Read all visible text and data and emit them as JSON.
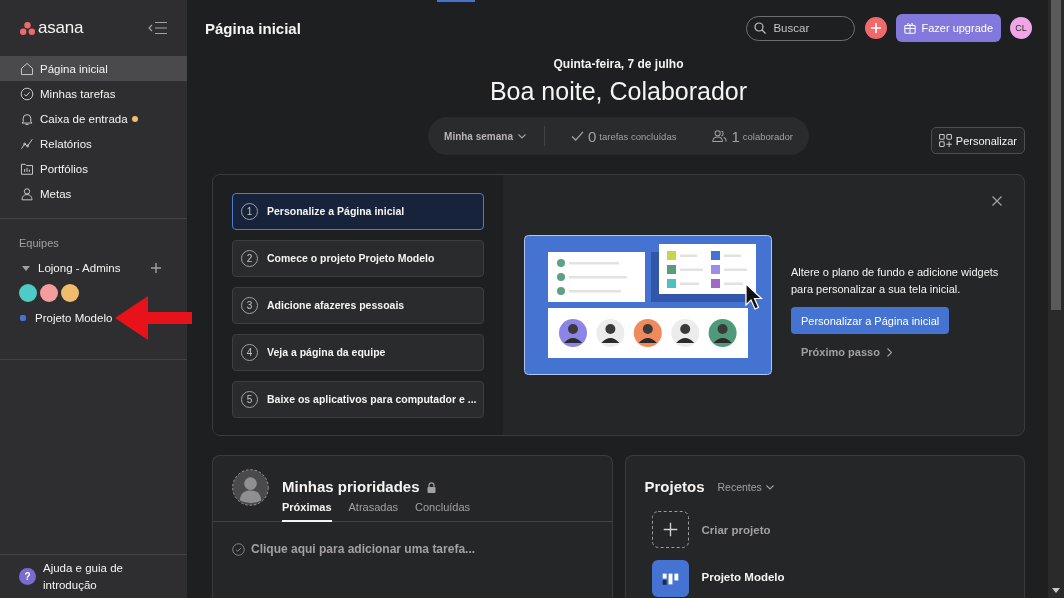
{
  "sidebar": {
    "logo": "asana",
    "nav": [
      {
        "label": "Página inicial",
        "selected": true,
        "unread": false
      },
      {
        "label": "Minhas tarefas",
        "selected": false,
        "unread": false
      },
      {
        "label": "Caixa de entrada",
        "selected": false,
        "unread": true
      },
      {
        "label": "Relatórios",
        "selected": false,
        "unread": false
      },
      {
        "label": "Portfólios",
        "selected": false,
        "unread": false
      },
      {
        "label": "Metas",
        "selected": false,
        "unread": false
      }
    ],
    "teams_heading": "Equipes",
    "team": {
      "name": "Lojong - Admins",
      "expanded": true,
      "members": [
        {
          "color": "#4ecbc4"
        },
        {
          "color": "#f59c9c"
        },
        {
          "color": "#f1bd6c"
        }
      ]
    },
    "projects": [
      {
        "name": "Projeto Modelo",
        "color": "#4573d2"
      }
    ],
    "help": {
      "icon": "?",
      "label": "Ajuda e guia de introdução"
    }
  },
  "header": {
    "title": "Página inicial",
    "search": {
      "placeholder": "Buscar"
    },
    "upgrade_button": "Fazer upgrade",
    "avatar": "CL"
  },
  "greeting": {
    "date": "Quinta-feira, 7 de julho",
    "title": "Boa noite, Colaborador"
  },
  "stats": {
    "period": "Minha semana",
    "tasks_count": "0",
    "tasks_label": "tarefas concluídas",
    "collaborators_count": "1",
    "collaborators_label": "colaborador"
  },
  "customize_button": "Personalizar",
  "onboarding": {
    "steps": [
      {
        "number": "1",
        "label": "Personalize a Página inicial",
        "selected": true
      },
      {
        "number": "2",
        "label": "Comece o projeto Projeto Modelo",
        "selected": false
      },
      {
        "number": "3",
        "label": "Adicione afazeres pessoais",
        "selected": false
      },
      {
        "number": "4",
        "label": "Veja a página da equipe",
        "selected": false
      },
      {
        "number": "5",
        "label": "Baixe os aplicativos para computador e ...",
        "selected": false
      }
    ],
    "description": "Altere o plano de fundo e adicione widgets para personalizar a sua tela inicial.",
    "primary_button": "Personalizar a Página inicial",
    "next_link": "Próximo passo"
  },
  "priorities": {
    "title": "Minhas prioridades",
    "tabs": [
      {
        "label": "Próximas",
        "selected": true
      },
      {
        "label": "Atrasadas",
        "selected": false
      },
      {
        "label": "Concluídas",
        "selected": false
      }
    ],
    "add_task": "Clique aqui para adicionar uma tarefa..."
  },
  "projects": {
    "title": "Projetos",
    "filter": "Recentes",
    "create": "Criar projeto",
    "items": [
      {
        "name": "Projeto Modelo",
        "color": "#4573d2"
      }
    ]
  }
}
